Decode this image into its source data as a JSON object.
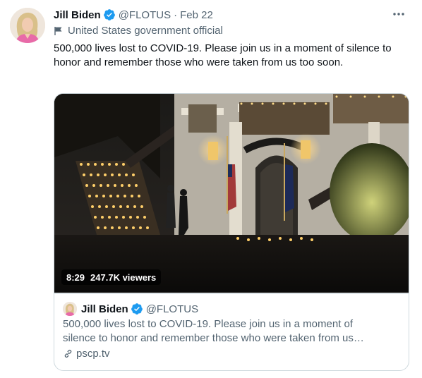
{
  "author": {
    "name": "Jill Biden",
    "handle": "@FLOTUS",
    "separator": "·",
    "date": "Feb 22",
    "label": "United States government official"
  },
  "tweet": {
    "text": "500,000 lives lost to COVID-19. Please join us in a moment of silence to honor and remember those who were taken from us too soon."
  },
  "card": {
    "duration": "8:29",
    "viewers": "247.7K viewers",
    "embed": {
      "name": "Jill Biden",
      "handle": "@FLOTUS",
      "text_line1": "500,000 lives lost to COVID-19. Please join us in a moment of",
      "text_line2": "silence to honor and remember those who were taken from us…"
    },
    "link": "pscp.tv"
  },
  "icons": {
    "more": "more-options-icon",
    "verified": "verified-badge-icon",
    "label": "flag-icon",
    "link": "link-icon"
  },
  "colors": {
    "verified": "#1d9bf0",
    "secondary_text": "#536471",
    "border": "#cfd9de",
    "accent": "#1d9bf0"
  }
}
